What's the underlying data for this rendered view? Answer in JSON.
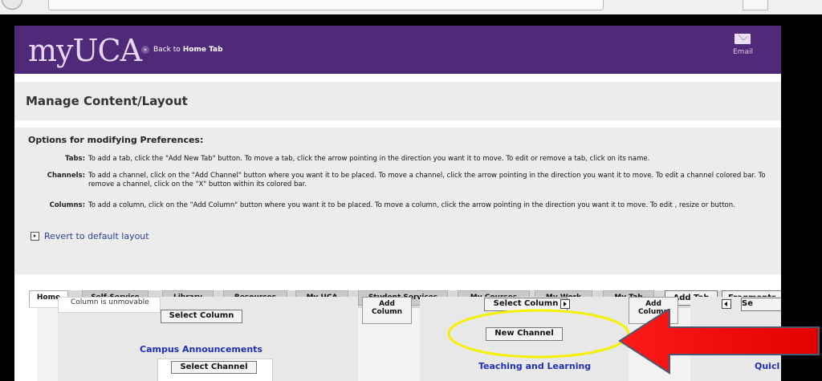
{
  "app": {
    "logo": "myUCA",
    "back_link_prefix": "Back to",
    "back_link_target": "Home Tab",
    "email_label": "Email"
  },
  "page": {
    "title": "Manage Content/Layout"
  },
  "options": {
    "title": "Options for modifying Preferences:",
    "rows": [
      {
        "label": "Tabs:",
        "text": "To add a tab, click the \"Add New Tab\" button. To move a tab, click the arrow pointing in the direction you want it to move. To edit or remove a tab, click on its name."
      },
      {
        "label": "Channels:",
        "text": "To add a channel, click on the \"Add Channel\" button where you want it to be placed. To move a channel, click the arrow pointing in the direction you want it to move. To edit a channel colored bar. To remove a channel, click on the \"X\" button within its colored bar."
      },
      {
        "label": "Columns:",
        "text": "To add a column, click on the \"Add Column\" button where you want it to be placed. To move a column, click the arrow pointing in the direction you want it to move. To edit , resize or button."
      }
    ],
    "revert_link": "Revert to default layout"
  },
  "tabs": [
    {
      "label": "Home"
    },
    {
      "label": "Self-Service"
    },
    {
      "label": "Library"
    },
    {
      "label": "Resources"
    },
    {
      "label": "My UCA"
    },
    {
      "label": "Student Services"
    },
    {
      "label": "My Courses"
    },
    {
      "label": "My Work"
    },
    {
      "label": "My Tab"
    }
  ],
  "tab_actions": {
    "add_tab": "Add Tab",
    "fragments": "Fragments"
  },
  "layout": {
    "col1_unmovable": "Column is unmovable",
    "select_column": "Select Column",
    "add_column": "Add Column",
    "new_channel": "New Channel",
    "select_channel": "Select Channel",
    "campus_announcements": "Campus Announcements",
    "teaching_learning": "Teaching and Learning",
    "quick_links": "Quicl",
    "select_partial": "Se"
  },
  "colors": {
    "header_purple": "#502a78",
    "link_blue": "#1f2fb5",
    "highlight_yellow": "#f3f000",
    "arrow_red": "#e60000"
  }
}
